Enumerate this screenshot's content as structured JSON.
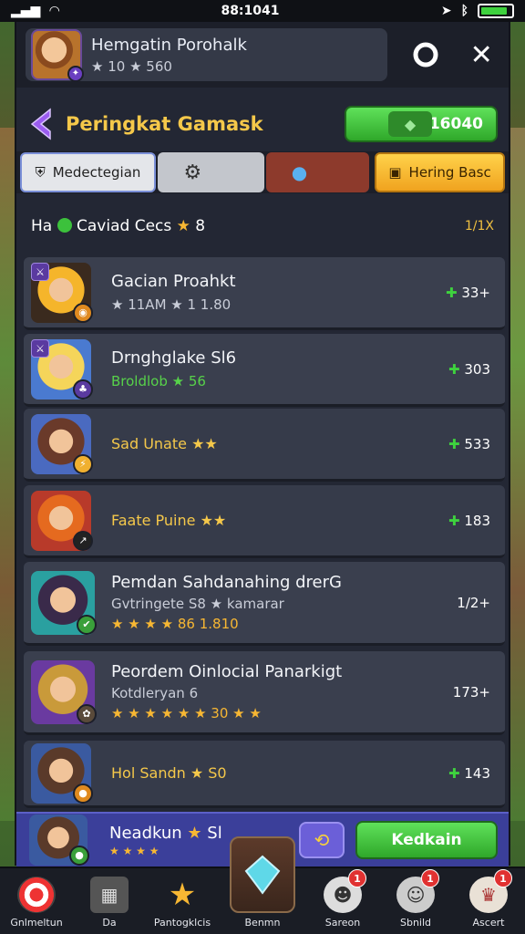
{
  "status_bar": {
    "time": "88:1041"
  },
  "profile": {
    "name": "Hemgatin Porohalk",
    "stats": "★ 10 ★ 560"
  },
  "header": {
    "title": "Peringkat Gamask",
    "currency_value": "16040"
  },
  "filters": [
    {
      "label": "Medectegian"
    },
    {
      "label": ""
    },
    {
      "label": ""
    },
    {
      "label": "Hering Basc"
    }
  ],
  "summary": {
    "left": "Ha",
    "text": "Caviad Cecs",
    "star_value": "8",
    "right": "1/1X"
  },
  "rankings": [
    {
      "name": "Gacian Proahkt",
      "sub": "★ 11AM ★ 1 1.80",
      "score": "33+",
      "sub_style": "normal",
      "name_style": "normal",
      "colors": [
        "#f5b52b",
        "#3a2a1e"
      ]
    },
    {
      "name": "Drnghglake Sl6",
      "sub": "Broldlob ★ 56",
      "score": "303",
      "sub_style": "green",
      "name_style": "normal",
      "colors": [
        "#f5d55a",
        "#4a7ad0"
      ]
    },
    {
      "name": "Sad Unate ★★",
      "sub": "",
      "score": "533",
      "sub_style": "normal",
      "name_style": "gold",
      "colors": [
        "#6a3a2a",
        "#4a6ac0"
      ]
    },
    {
      "name": "Faate Puine ★★",
      "sub": "",
      "score": "183",
      "sub_style": "normal",
      "name_style": "gold",
      "colors": [
        "#e56a1f",
        "#b83a2a"
      ]
    },
    {
      "name": "Pemdan Sahdanahing drerG",
      "sub": "Gvtringete S8 ★ kamarar",
      "sub2": "★ ★ ★ ★ 86 1.810",
      "score": "1/2+",
      "sub_style": "normal",
      "name_style": "normal",
      "colors": [
        "#3a2a4a",
        "#2aa0a0"
      ]
    },
    {
      "name": "Peordem Oinlocial Panarkigt",
      "sub": "Kotdleryan 6",
      "sub2": "★ ★ ★ ★ ★ ★ 30 ★ ★",
      "score": "173+",
      "sub_style": "normal",
      "name_style": "normal",
      "colors": [
        "#c99a3a",
        "#6a3aa0"
      ]
    },
    {
      "name": "Hol Sandn ★ S0",
      "sub": "",
      "score": "143",
      "sub_style": "normal",
      "name_style": "gold",
      "colors": [
        "#5a3a2a",
        "#3a5aa0"
      ]
    }
  ],
  "highlight": {
    "name": "Neadkun",
    "star_value": "Sl",
    "stars": "★ ★ ★ ★",
    "action_label": "Kedkain"
  },
  "bottom_nav": [
    {
      "label": "Gnlmeltun",
      "icon": "target-icon",
      "badge": ""
    },
    {
      "label": "Da",
      "icon": "box-icon",
      "badge": ""
    },
    {
      "label": "Pantogklcis",
      "icon": "star-icon",
      "badge": ""
    },
    {
      "label": "Benmn",
      "icon": "gem-icon",
      "badge": "",
      "active": true
    },
    {
      "label": "Sareon",
      "icon": "face-icon",
      "badge": "1"
    },
    {
      "label": "Sbnild",
      "icon": "ghost-icon",
      "badge": "1"
    },
    {
      "label": "Ascert",
      "icon": "chef-icon",
      "badge": "1"
    }
  ],
  "colors": {
    "accent_gold": "#f5c84a",
    "accent_green": "#3ed23e",
    "panel": "#232734",
    "card": "#3a3f4e",
    "highlight": "#3b3f9a"
  }
}
